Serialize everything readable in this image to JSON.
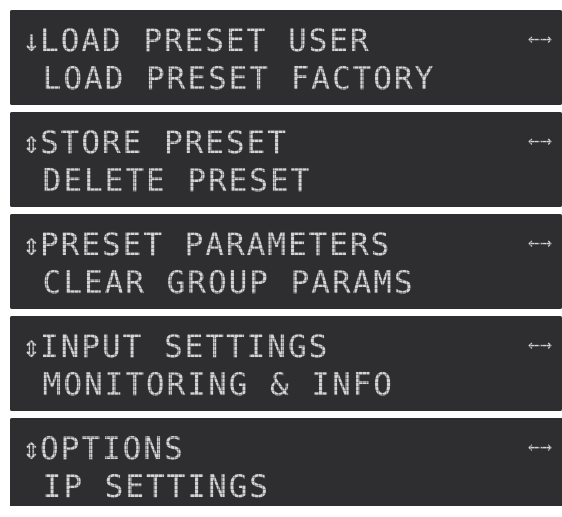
{
  "screens": [
    {
      "cursor": "↓",
      "line1": "LOAD PRESET USER",
      "line2": " LOAD PRESET FACTORY",
      "arrows": "←→"
    },
    {
      "cursor": "⇕",
      "line1": "STORE PRESET",
      "line2": " DELETE PRESET",
      "arrows": "←→"
    },
    {
      "cursor": "⇕",
      "line1": "PRESET PARAMETERS",
      "line2": " CLEAR GROUP PARAMS",
      "arrows": "←→"
    },
    {
      "cursor": "⇕",
      "line1": "INPUT SETTINGS",
      "line2": " MONITORING & INFO",
      "arrows": "←→"
    },
    {
      "cursor": "⇕",
      "line1": "OPTIONS",
      "line2": " IP SETTINGS",
      "arrows": "←→"
    }
  ],
  "colors": {
    "screen_bg": "#2e2e31",
    "lcd_text": "#d4d4d4"
  }
}
